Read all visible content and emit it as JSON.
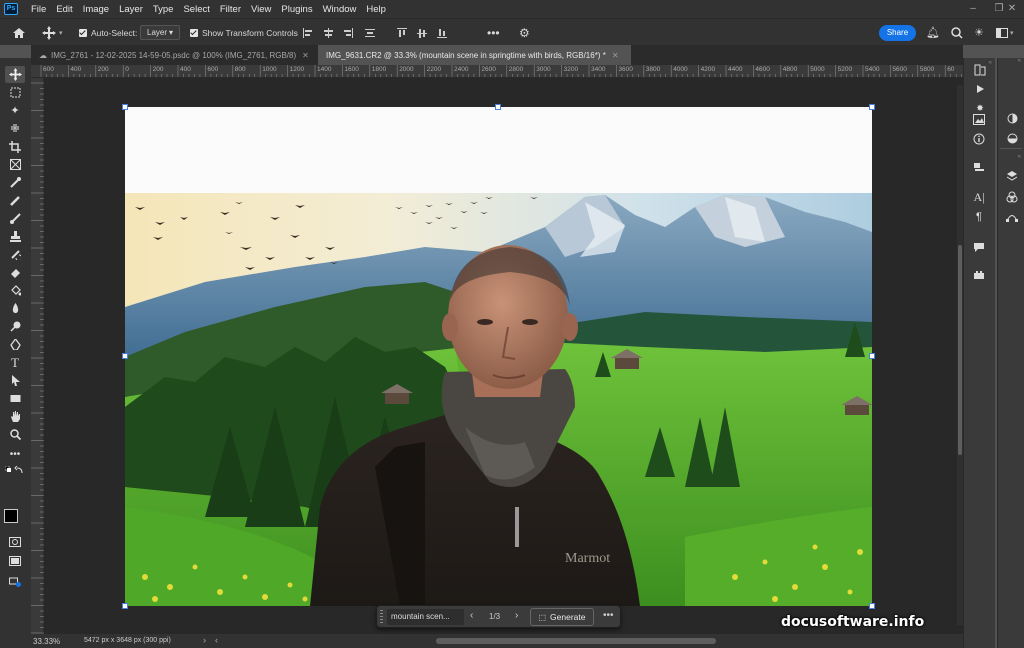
{
  "app": {
    "logo_text": "Ps"
  },
  "menu": [
    "File",
    "Edit",
    "Image",
    "Layer",
    "Type",
    "Select",
    "Filter",
    "View",
    "Plugins",
    "Window",
    "Help"
  ],
  "options_bar": {
    "auto_select_label": "Auto-Select:",
    "auto_select_value": "Layer",
    "show_transform_label": "Show Transform Controls",
    "share_label": "Share"
  },
  "tabs": [
    {
      "label": "IMG_2761 - 12-02-2025 14-59-05.psdc @ 100% (IMG_2761, RGB/8)",
      "active": false
    },
    {
      "label": "IMG_9631.CR2 @ 33.3% (mountain scene in springtime with birds, RGB/16*) *",
      "active": true
    }
  ],
  "ruler_ticks": [
    "600",
    "400",
    "200",
    "0",
    "200",
    "400",
    "600",
    "800",
    "1000",
    "1200",
    "1400",
    "1600",
    "1800",
    "2000",
    "2200",
    "2400",
    "2600",
    "2800",
    "3000",
    "3200",
    "3400",
    "3600",
    "3800",
    "4000",
    "4200",
    "4400",
    "4600",
    "4800",
    "5000",
    "5200",
    "5400",
    "5600",
    "5800",
    "60"
  ],
  "context_bar": {
    "prompt": "mountain scen...",
    "variation": "1/3",
    "generate_label": "Generate"
  },
  "status": {
    "zoom": "33.33%",
    "doc_info": "5472 px x 3648 px (300 ppi)"
  },
  "watermark": "docusoftware.info",
  "colors": {
    "accent": "#1473e6",
    "fg_color": "#000000",
    "bg_color": "#ffffff"
  }
}
